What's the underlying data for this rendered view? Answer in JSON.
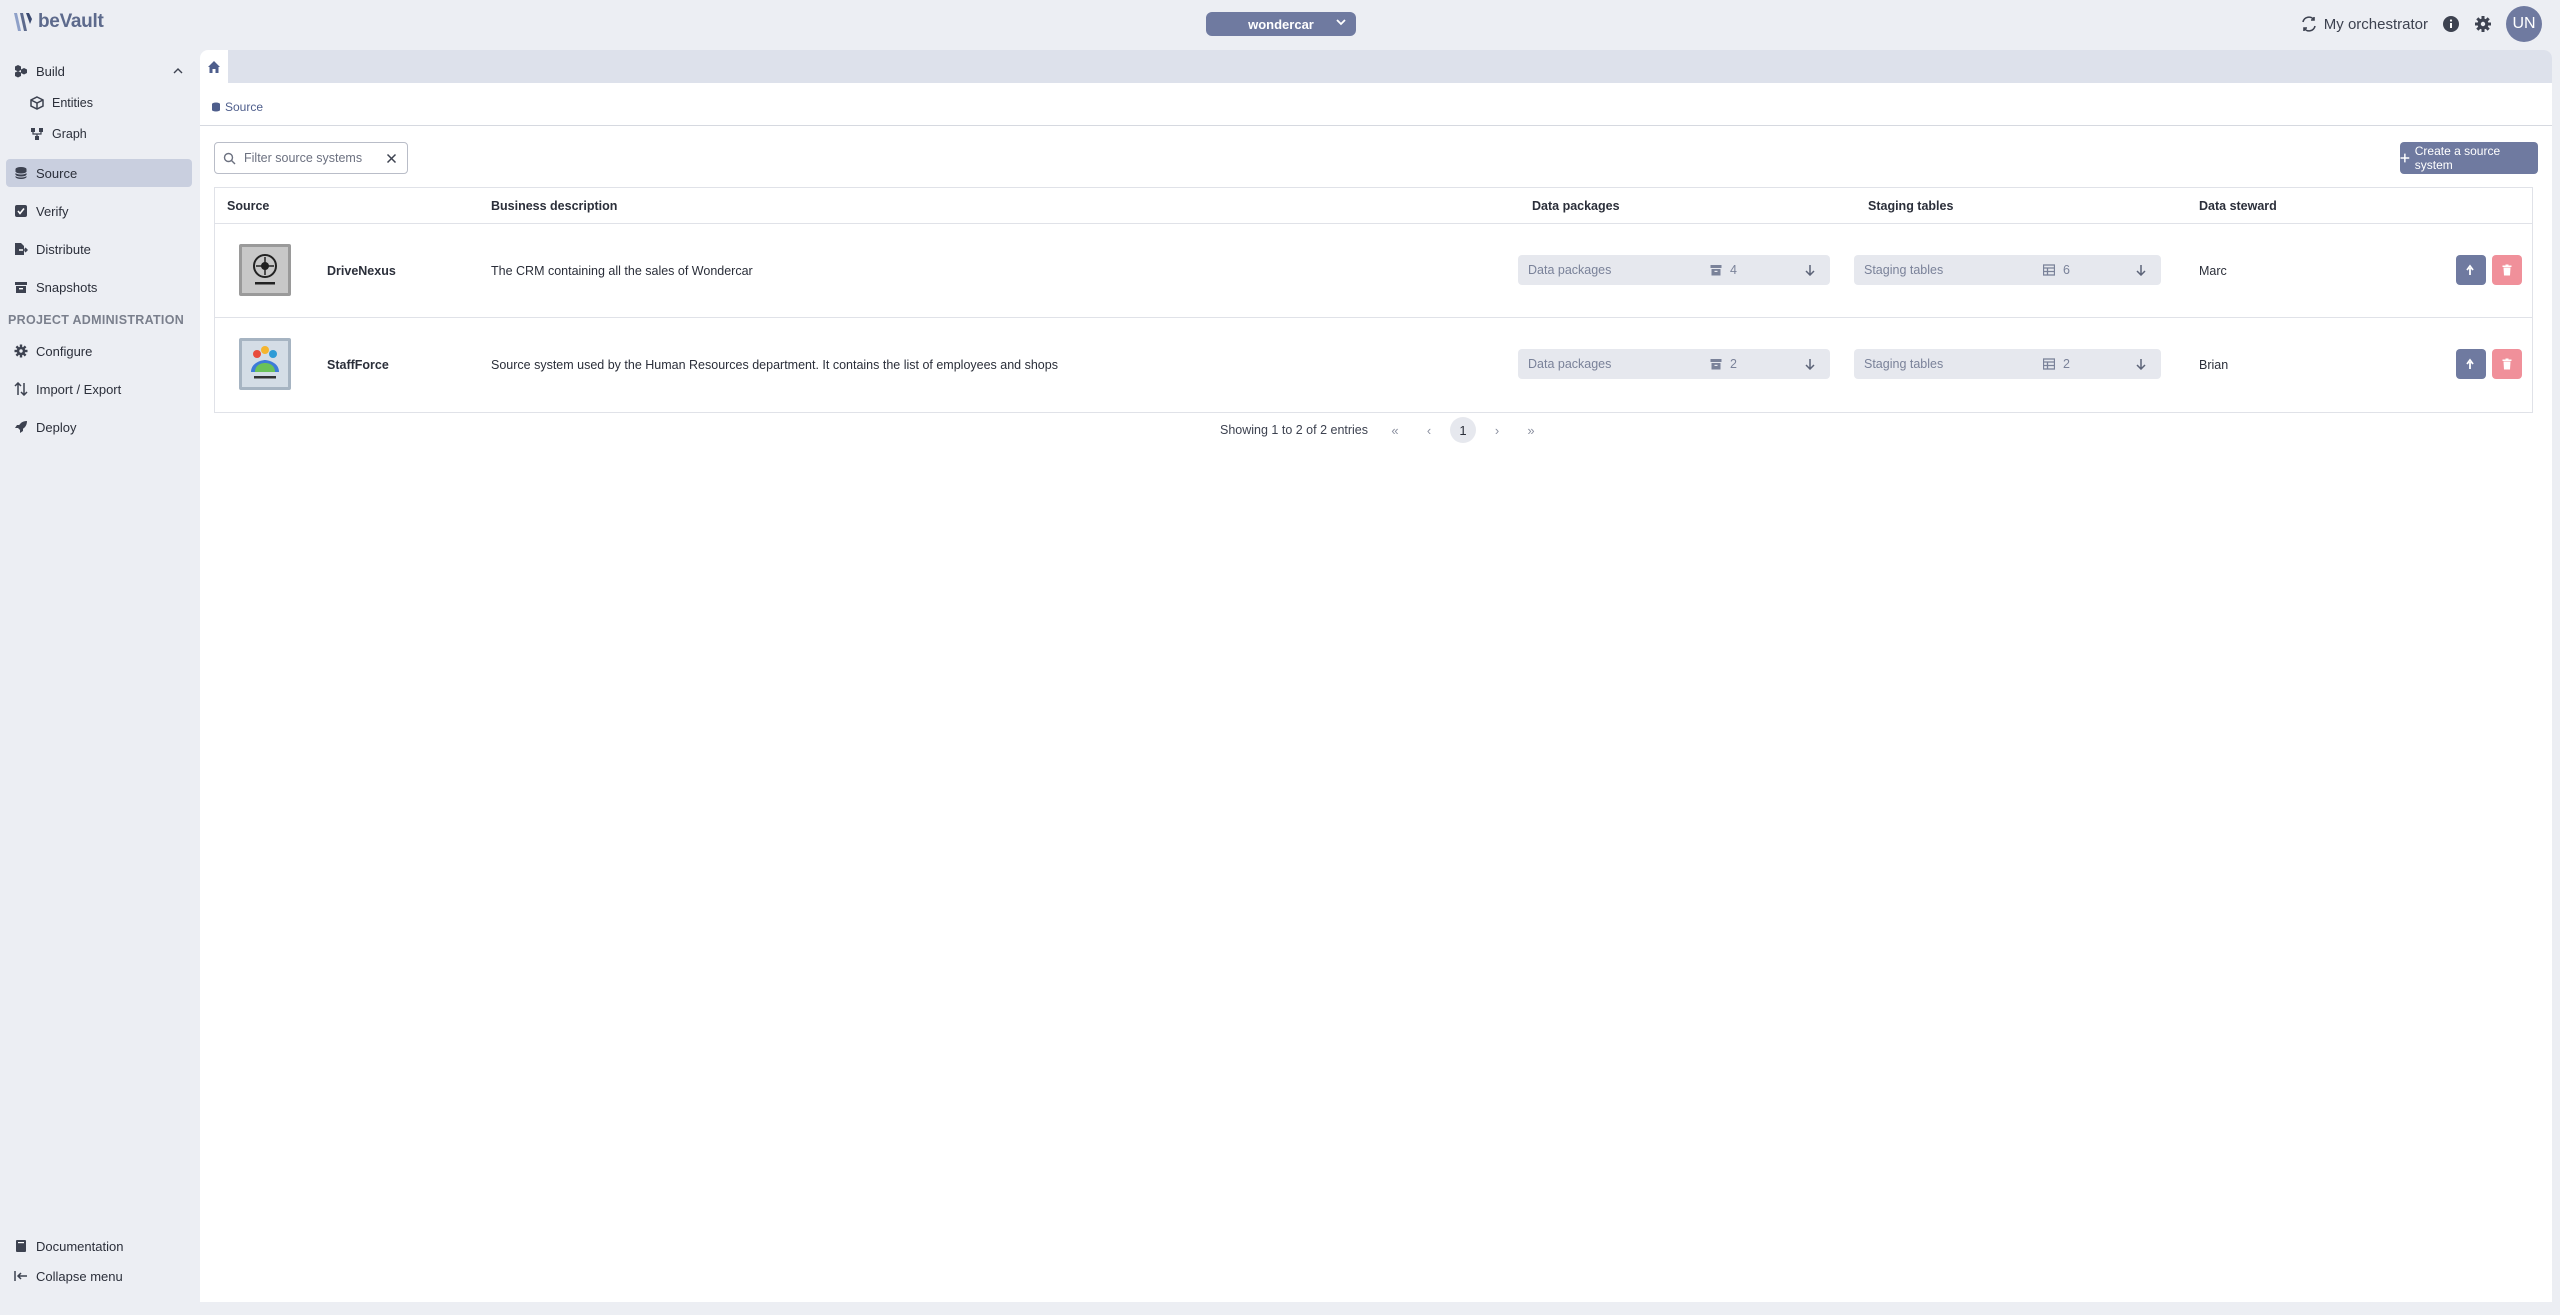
{
  "app": {
    "name": "beVault"
  },
  "header": {
    "project": "wondercar",
    "orchestrator_label": "My orchestrator",
    "avatar_initials": "UN"
  },
  "sidebar": {
    "build": "Build",
    "entities": "Entities",
    "graph": "Graph",
    "source": "Source",
    "verify": "Verify",
    "distribute": "Distribute",
    "snapshots": "Snapshots",
    "project_admin_title": "PROJECT ADMINISTRATION",
    "configure": "Configure",
    "import_export": "Import / Export",
    "deploy": "Deploy",
    "documentation": "Documentation",
    "collapse_menu": "Collapse menu"
  },
  "breadcrumb": {
    "current": "Source"
  },
  "toolbar": {
    "filter_placeholder": "Filter source systems",
    "create_label": "Create a source system"
  },
  "table": {
    "columns": {
      "source": "Source",
      "business_description": "Business description",
      "data_packages": "Data packages",
      "staging_tables": "Staging tables",
      "data_steward": "Data steward"
    },
    "rows": [
      {
        "name": "DriveNexus",
        "description": "The CRM containing all the sales of Wondercar",
        "data_packages_label": "Data packages",
        "data_packages_count": "4",
        "staging_tables_label": "Staging tables",
        "staging_tables_count": "6",
        "steward": "Marc"
      },
      {
        "name": "StaffForce",
        "description": "Source system used by the Human Resources department. It contains the list of employees and shops",
        "data_packages_label": "Data packages",
        "data_packages_count": "2",
        "staging_tables_label": "Staging tables",
        "staging_tables_count": "2",
        "steward": "Brian"
      }
    ]
  },
  "pagination": {
    "info": "Showing 1 to 2 of 2 entries",
    "first": "«",
    "prev": "‹",
    "current_page": "1",
    "next": "›",
    "last": "»"
  },
  "colors": {
    "accent": "#6f7aa0",
    "danger": "#f0909a",
    "active_nav": "#c9cfdf",
    "background": "#eceef3"
  },
  "icons": {
    "build": "cubes-icon",
    "entities": "cube-icon",
    "graph": "graph-icon",
    "source": "database-icon",
    "verify": "check-square-icon",
    "distribute": "file-export-icon",
    "snapshots": "archive-icon",
    "configure": "gear-icon",
    "import_export": "arrows-up-down-icon",
    "deploy": "rocket-icon",
    "documentation": "book-icon",
    "collapse": "collapse-left-icon"
  }
}
